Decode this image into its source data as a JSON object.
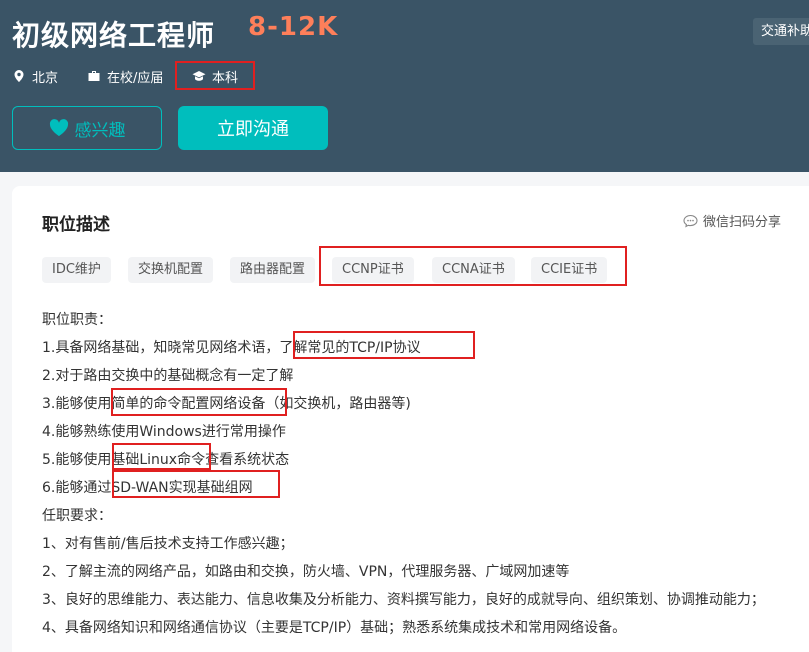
{
  "job": {
    "title": "初级网络工程师",
    "salary": "8-12K",
    "benefit": "交通补助",
    "city": "北京",
    "experience": "在校/应届",
    "education": "本科"
  },
  "actions": {
    "interest": "感兴趣",
    "chat": "立即沟通"
  },
  "section": {
    "title": "职位描述",
    "share": "微信扫码分享"
  },
  "tags": [
    "IDC维护",
    "交换机配置",
    "路由器配置",
    "CCNP证书",
    "CCNA证书",
    "CCIE证书"
  ],
  "description": [
    "职位职责：",
    "1.具备网络基础，知晓常见网络术语，了解常见的TCP/IP协议",
    "2.对于路由交换中的基础概念有一定了解",
    "3.能够使用简单的命令配置网络设备（如交换机，路由器等)",
    "4.能够熟练使用Windows进行常用操作",
    "5.能够使用基础Linux命令查看系统状态",
    "6.能够通过SD-WAN实现基础组网",
    "任职要求：",
    "1、对有售前/售后技术支持工作感兴趣；",
    "2、了解主流的网络产品，如路由和交换，防火墙、VPN，代理服务器、广域网加速等",
    "3、良好的思维能力、表达能力、信息收集及分析能力、资料撰写能力，良好的成就导向、组织策划、协调推动能力；",
    "4、具备网络知识和网络通信协议（主要是TCP/IP）基础；熟悉系统集成技术和常用网络设备。"
  ],
  "icons": {
    "location": "location-icon",
    "briefcase": "briefcase-icon",
    "graduation": "graduation-cap-icon",
    "heart": "heart-icon",
    "wechat": "wechat-icon"
  },
  "colors": {
    "header_bg": "#3a5466",
    "accent": "#00bebd",
    "salary": "#fe7f5a",
    "highlight": "#e02020"
  }
}
